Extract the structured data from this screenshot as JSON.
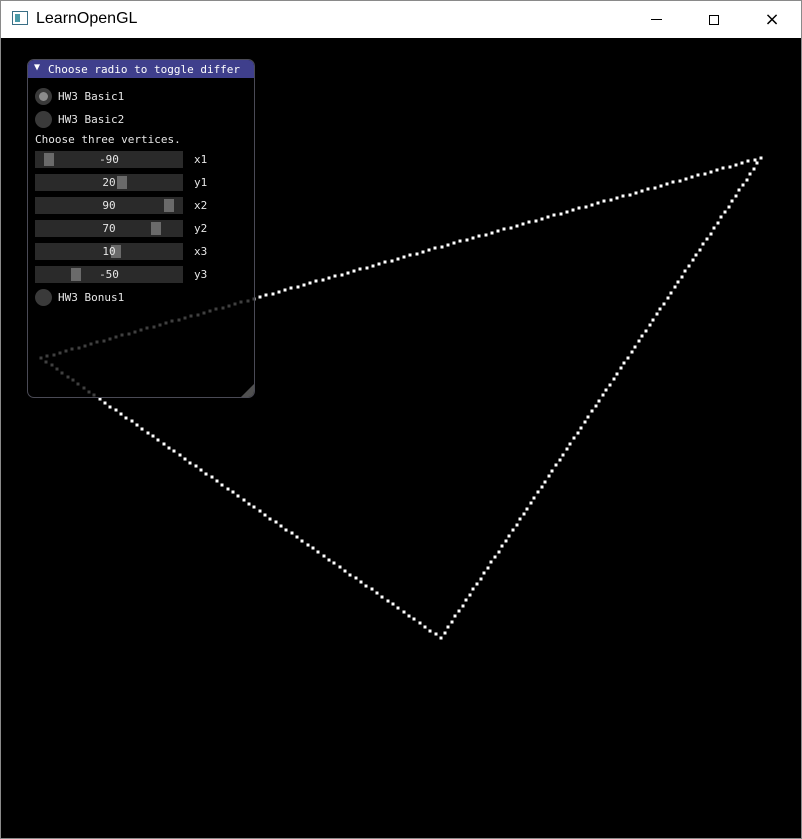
{
  "window": {
    "title": "LearnOpenGL",
    "controls": {
      "minimize": "minimize-icon",
      "maximize": "maximize-icon",
      "close": "×"
    }
  },
  "panel": {
    "title": "Choose radio to toggle differ",
    "radios": [
      {
        "label": "HW3 Basic1",
        "selected": true
      },
      {
        "label": "HW3 Basic2",
        "selected": false
      }
    ],
    "instruction": "Choose three vertices.",
    "sliders": [
      {
        "label": "x1",
        "value": -90
      },
      {
        "label": "y1",
        "value": 20
      },
      {
        "label": "x2",
        "value": 90
      },
      {
        "label": "y2",
        "value": 70
      },
      {
        "label": "x3",
        "value": 10
      },
      {
        "label": "y3",
        "value": -50
      }
    ],
    "slider_range": [
      -100,
      100
    ],
    "bonus_radio": {
      "label": "HW3 Bonus1",
      "selected": false
    }
  },
  "scene": {
    "type": "triangle-outline",
    "vertices": [
      [
        -90,
        20
      ],
      [
        90,
        70
      ],
      [
        10,
        -50
      ]
    ],
    "coordinate_range": [
      -100,
      100
    ],
    "point_color": "#ffffff",
    "background_color": "#000000"
  }
}
